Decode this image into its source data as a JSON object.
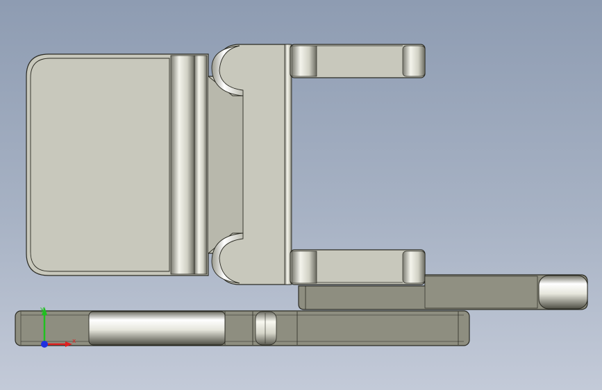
{
  "viewport": {
    "background_top": "#8e9cb2",
    "background_bottom": "#c3cad8"
  },
  "model": {
    "part_fill": "#c8c8bc",
    "part_shadow_fill": "#8e8e80",
    "edge_color": "#2a2a22",
    "highlight": "#ffffff"
  },
  "triad": {
    "x_label": "x",
    "y_label": "y",
    "x_color": "#e02020",
    "y_color": "#20c020",
    "z_color": "#2030e0"
  }
}
